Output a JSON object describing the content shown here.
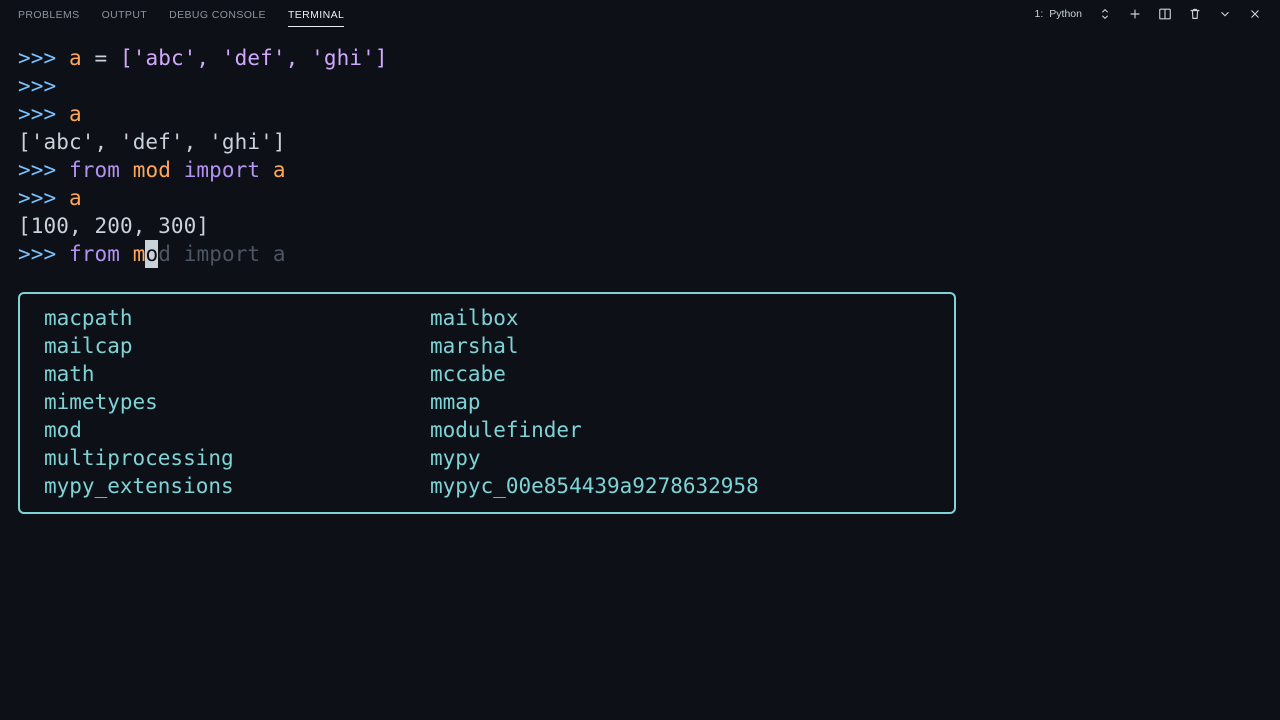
{
  "tabs": {
    "problems": "PROBLEMS",
    "output": "OUTPUT",
    "debug": "DEBUG CONSOLE",
    "terminal": "TERMINAL"
  },
  "session": {
    "index": "1:",
    "name": "Python"
  },
  "lines": {
    "l1_assign_var": "a",
    "l1_eq": " = ",
    "l1_val": "['abc', 'def', 'ghi']",
    "l3_var": "a",
    "l4_out": "['abc', 'def', 'ghi']",
    "l5_from": "from",
    "l5_mod": " mod ",
    "l5_import": "import",
    "l5_name": " a",
    "l6_var": "a",
    "l7_out": "[100, 200, 300]",
    "l8_from": "from",
    "l8_typed_pre": " m",
    "l8_typed_cursor": "o",
    "l8_ghost": "d ",
    "l8_ghost_import": "import",
    "l8_ghost_name": " a"
  },
  "prompt": ">>> ",
  "suggestions": {
    "c1": [
      "macpath",
      "mailcap",
      "math",
      "mimetypes",
      "mod",
      "multiprocessing",
      "mypy_extensions"
    ],
    "c2": [
      "mailbox",
      "marshal",
      "mccabe",
      "mmap",
      "modulefinder",
      "mypy",
      "mypyc_00e854439a9278632958"
    ]
  }
}
